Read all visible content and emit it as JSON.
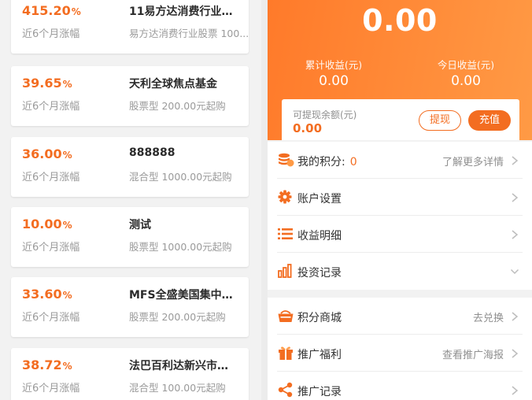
{
  "fund_list": {
    "items": [
      {
        "rate": "415.20",
        "pct": "%",
        "rate_label": "近6个月涨幅",
        "name": "11易方达消费行业…",
        "desc": "易方达消费行业股票 100..."
      },
      {
        "rate": "39.65",
        "pct": "%",
        "rate_label": "近6个月涨幅",
        "name": "天利全球焦点基金",
        "desc": "股票型 200.00元起购"
      },
      {
        "rate": "36.00",
        "pct": "%",
        "rate_label": "近6个月涨幅",
        "name": "888888",
        "desc": "混合型 1000.00元起购"
      },
      {
        "rate": "10.00",
        "pct": "%",
        "rate_label": "近6个月涨幅",
        "name": "测试",
        "desc": "股票型 1000.00元起购"
      },
      {
        "rate": "33.60",
        "pct": "%",
        "rate_label": "近6个月涨幅",
        "name": "MFS全盛美国集中…",
        "desc": "股票型 200.00元起购"
      },
      {
        "rate": "38.72",
        "pct": "%",
        "rate_label": "近6个月涨幅",
        "name": "法巴百利达新兴市…",
        "desc": "混合型 100.00元起购"
      }
    ]
  },
  "account": {
    "total_assets": "0.00",
    "cumulative_income_label": "累计收益(元)",
    "cumulative_income": "0.00",
    "today_income_label": "今日收益(元)",
    "today_income": "0.00",
    "withdrawable_label": "可提现余额(元)",
    "withdrawable": "0.00",
    "withdraw_button": "提现",
    "recharge_button": "充值"
  },
  "menu_group_1": [
    {
      "icon": "coins-icon",
      "label": "我的积分:",
      "points": "0",
      "hint": "了解更多详情",
      "chevron": "right"
    },
    {
      "icon": "gear-icon",
      "label": "账户设置",
      "hint": "",
      "chevron": "right"
    },
    {
      "icon": "list-icon",
      "label": "收益明细",
      "hint": "",
      "chevron": "right"
    },
    {
      "icon": "bar-chart-icon",
      "label": "投资记录",
      "hint": "",
      "chevron": "down"
    }
  ],
  "menu_group_2": [
    {
      "icon": "basket-icon",
      "label": "积分商城",
      "hint": "去兑换",
      "chevron": "right"
    },
    {
      "icon": "gift-icon",
      "label": "推广福利",
      "hint": "查看推广海报",
      "chevron": "right"
    },
    {
      "icon": "share-icon",
      "label": "推广记录",
      "hint": "",
      "chevron": "right"
    }
  ],
  "colors": {
    "accent": "#f36d21",
    "hero_start": "#ff7a2a",
    "hero_end": "#ff9a45"
  }
}
